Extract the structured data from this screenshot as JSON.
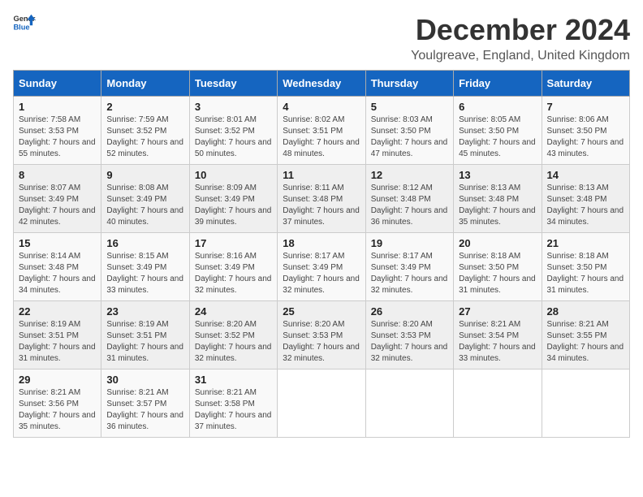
{
  "logo": {
    "text_general": "General",
    "text_blue": "Blue"
  },
  "header": {
    "title": "December 2024",
    "subtitle": "Youlgreave, England, United Kingdom"
  },
  "days_of_week": [
    "Sunday",
    "Monday",
    "Tuesday",
    "Wednesday",
    "Thursday",
    "Friday",
    "Saturday"
  ],
  "weeks": [
    [
      {
        "day": "1",
        "sunrise": "Sunrise: 7:58 AM",
        "sunset": "Sunset: 3:53 PM",
        "daylight": "Daylight: 7 hours and 55 minutes."
      },
      {
        "day": "2",
        "sunrise": "Sunrise: 7:59 AM",
        "sunset": "Sunset: 3:52 PM",
        "daylight": "Daylight: 7 hours and 52 minutes."
      },
      {
        "day": "3",
        "sunrise": "Sunrise: 8:01 AM",
        "sunset": "Sunset: 3:52 PM",
        "daylight": "Daylight: 7 hours and 50 minutes."
      },
      {
        "day": "4",
        "sunrise": "Sunrise: 8:02 AM",
        "sunset": "Sunset: 3:51 PM",
        "daylight": "Daylight: 7 hours and 48 minutes."
      },
      {
        "day": "5",
        "sunrise": "Sunrise: 8:03 AM",
        "sunset": "Sunset: 3:50 PM",
        "daylight": "Daylight: 7 hours and 47 minutes."
      },
      {
        "day": "6",
        "sunrise": "Sunrise: 8:05 AM",
        "sunset": "Sunset: 3:50 PM",
        "daylight": "Daylight: 7 hours and 45 minutes."
      },
      {
        "day": "7",
        "sunrise": "Sunrise: 8:06 AM",
        "sunset": "Sunset: 3:50 PM",
        "daylight": "Daylight: 7 hours and 43 minutes."
      }
    ],
    [
      {
        "day": "8",
        "sunrise": "Sunrise: 8:07 AM",
        "sunset": "Sunset: 3:49 PM",
        "daylight": "Daylight: 7 hours and 42 minutes."
      },
      {
        "day": "9",
        "sunrise": "Sunrise: 8:08 AM",
        "sunset": "Sunset: 3:49 PM",
        "daylight": "Daylight: 7 hours and 40 minutes."
      },
      {
        "day": "10",
        "sunrise": "Sunrise: 8:09 AM",
        "sunset": "Sunset: 3:49 PM",
        "daylight": "Daylight: 7 hours and 39 minutes."
      },
      {
        "day": "11",
        "sunrise": "Sunrise: 8:11 AM",
        "sunset": "Sunset: 3:48 PM",
        "daylight": "Daylight: 7 hours and 37 minutes."
      },
      {
        "day": "12",
        "sunrise": "Sunrise: 8:12 AM",
        "sunset": "Sunset: 3:48 PM",
        "daylight": "Daylight: 7 hours and 36 minutes."
      },
      {
        "day": "13",
        "sunrise": "Sunrise: 8:13 AM",
        "sunset": "Sunset: 3:48 PM",
        "daylight": "Daylight: 7 hours and 35 minutes."
      },
      {
        "day": "14",
        "sunrise": "Sunrise: 8:13 AM",
        "sunset": "Sunset: 3:48 PM",
        "daylight": "Daylight: 7 hours and 34 minutes."
      }
    ],
    [
      {
        "day": "15",
        "sunrise": "Sunrise: 8:14 AM",
        "sunset": "Sunset: 3:48 PM",
        "daylight": "Daylight: 7 hours and 34 minutes."
      },
      {
        "day": "16",
        "sunrise": "Sunrise: 8:15 AM",
        "sunset": "Sunset: 3:49 PM",
        "daylight": "Daylight: 7 hours and 33 minutes."
      },
      {
        "day": "17",
        "sunrise": "Sunrise: 8:16 AM",
        "sunset": "Sunset: 3:49 PM",
        "daylight": "Daylight: 7 hours and 32 minutes."
      },
      {
        "day": "18",
        "sunrise": "Sunrise: 8:17 AM",
        "sunset": "Sunset: 3:49 PM",
        "daylight": "Daylight: 7 hours and 32 minutes."
      },
      {
        "day": "19",
        "sunrise": "Sunrise: 8:17 AM",
        "sunset": "Sunset: 3:49 PM",
        "daylight": "Daylight: 7 hours and 32 minutes."
      },
      {
        "day": "20",
        "sunrise": "Sunrise: 8:18 AM",
        "sunset": "Sunset: 3:50 PM",
        "daylight": "Daylight: 7 hours and 31 minutes."
      },
      {
        "day": "21",
        "sunrise": "Sunrise: 8:18 AM",
        "sunset": "Sunset: 3:50 PM",
        "daylight": "Daylight: 7 hours and 31 minutes."
      }
    ],
    [
      {
        "day": "22",
        "sunrise": "Sunrise: 8:19 AM",
        "sunset": "Sunset: 3:51 PM",
        "daylight": "Daylight: 7 hours and 31 minutes."
      },
      {
        "day": "23",
        "sunrise": "Sunrise: 8:19 AM",
        "sunset": "Sunset: 3:51 PM",
        "daylight": "Daylight: 7 hours and 31 minutes."
      },
      {
        "day": "24",
        "sunrise": "Sunrise: 8:20 AM",
        "sunset": "Sunset: 3:52 PM",
        "daylight": "Daylight: 7 hours and 32 minutes."
      },
      {
        "day": "25",
        "sunrise": "Sunrise: 8:20 AM",
        "sunset": "Sunset: 3:53 PM",
        "daylight": "Daylight: 7 hours and 32 minutes."
      },
      {
        "day": "26",
        "sunrise": "Sunrise: 8:20 AM",
        "sunset": "Sunset: 3:53 PM",
        "daylight": "Daylight: 7 hours and 32 minutes."
      },
      {
        "day": "27",
        "sunrise": "Sunrise: 8:21 AM",
        "sunset": "Sunset: 3:54 PM",
        "daylight": "Daylight: 7 hours and 33 minutes."
      },
      {
        "day": "28",
        "sunrise": "Sunrise: 8:21 AM",
        "sunset": "Sunset: 3:55 PM",
        "daylight": "Daylight: 7 hours and 34 minutes."
      }
    ],
    [
      {
        "day": "29",
        "sunrise": "Sunrise: 8:21 AM",
        "sunset": "Sunset: 3:56 PM",
        "daylight": "Daylight: 7 hours and 35 minutes."
      },
      {
        "day": "30",
        "sunrise": "Sunrise: 8:21 AM",
        "sunset": "Sunset: 3:57 PM",
        "daylight": "Daylight: 7 hours and 36 minutes."
      },
      {
        "day": "31",
        "sunrise": "Sunrise: 8:21 AM",
        "sunset": "Sunset: 3:58 PM",
        "daylight": "Daylight: 7 hours and 37 minutes."
      },
      null,
      null,
      null,
      null
    ]
  ]
}
